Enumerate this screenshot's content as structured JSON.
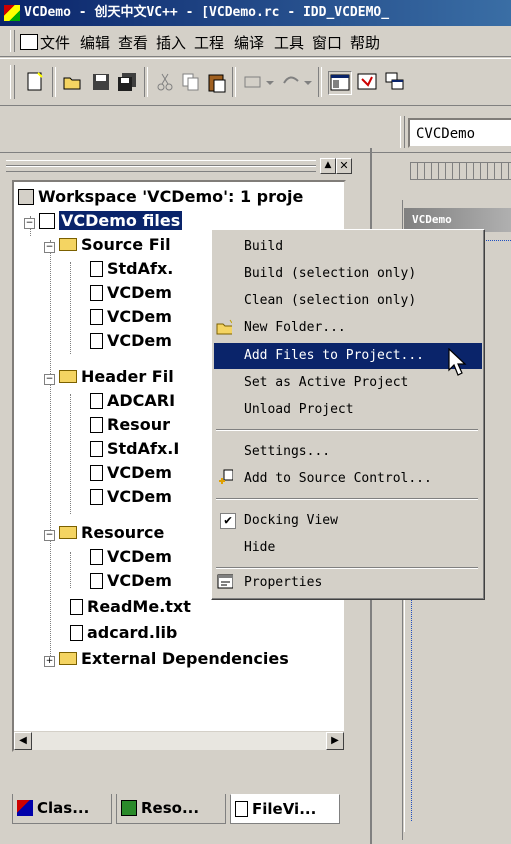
{
  "title_bar": {
    "text": "VCDemo - 创天中文VC++ - [VCDemo.rc - IDD_VCDEMO_"
  },
  "menubar": {
    "items": [
      "文件",
      "编辑",
      "查看",
      "插入",
      "工程",
      "编译",
      "工具",
      "窗口",
      "帮助"
    ]
  },
  "class_combo": {
    "value": "CVCDemo"
  },
  "workspace": {
    "root": "Workspace 'VCDemo': 1 proje",
    "project": "VCDemo files",
    "source_folder": "Source Fil",
    "source_files": [
      "StdAfx.",
      "VCDem",
      "VCDem",
      "VCDem"
    ],
    "header_folder": "Header Fil",
    "header_files": [
      "ADCARI",
      "Resour",
      "StdAfx.I",
      "VCDem",
      "VCDem"
    ],
    "resource_folder": "Resource",
    "resource_files": [
      "VCDem",
      "VCDem"
    ],
    "readme": "ReadMe.txt",
    "lib": "adcard.lib",
    "external": "External Dependencies"
  },
  "tabs": [
    "Clas...",
    "Reso...",
    "FileVi..."
  ],
  "editor": {
    "dialog_title": "VCDemo"
  },
  "context_menu": {
    "items": [
      {
        "label": "Build"
      },
      {
        "label": "Build (selection only)"
      },
      {
        "label": "Clean (selection only)"
      },
      {
        "label": "New Folder..."
      },
      {
        "label": "Add Files to Project..."
      },
      {
        "label": "Set as Active Project"
      },
      {
        "label": "Unload Project"
      },
      {
        "label": "Settings..."
      },
      {
        "label": "Add to Source Control..."
      },
      {
        "label": "Docking View"
      },
      {
        "label": "Hide"
      },
      {
        "label": "Properties"
      }
    ],
    "highlighted": "Add Files to Project...",
    "checked": "Docking View"
  },
  "colors": {
    "selection": "#0a246a",
    "face": "#d4d0c8"
  }
}
